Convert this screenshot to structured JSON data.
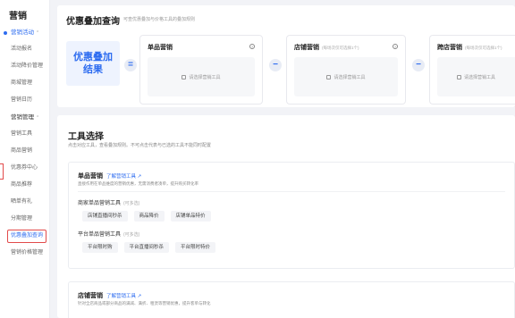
{
  "sidebar": {
    "title": "营销",
    "groups": [
      {
        "label": "营销活动",
        "items": [
          "活动报名",
          "活动降价管理",
          "商城管理",
          "营销日历"
        ]
      },
      {
        "label": "营销管理",
        "items": [
          "营销工具",
          "商品营销",
          "优惠券中心",
          "商品推荐",
          "晒单有礼",
          "分期管理",
          "优惠叠加查询",
          "营销价格管理"
        ]
      }
    ],
    "chevron": "⌃"
  },
  "card1": {
    "title": "优惠叠加查询",
    "desc": "可查优惠叠加与价格工具的叠加规则",
    "result": [
      "优惠叠加",
      "结果"
    ],
    "operators": [
      "=",
      "−",
      "−"
    ],
    "slots": [
      {
        "title": "单品营销",
        "sub": "",
        "placeholder": "请选择营销工具"
      },
      {
        "title": "店铺营销",
        "sub": "(每场次仅可选择1个)",
        "placeholder": "请选择营销工具"
      },
      {
        "title": "跨店营销",
        "sub": "(每场次仅可选择1个)",
        "placeholder": "请选择营销工具"
      }
    ]
  },
  "card2": {
    "title": "工具选择",
    "desc": "点击对应工具，查看叠加规则。不可点击代表与已选的工具不能同时配置",
    "tool1": {
      "title": "单品营销",
      "link": "了解营销工具",
      "desc": "直接作用在单品维度的营销优惠，无需消费者凑单，提升购买转化率",
      "sections": [
        {
          "label": "商家单品营销工具",
          "optional": "(可多选)",
          "chips": [
            "店铺直播间秒杀",
            "商品降价",
            "店铺单品特价"
          ]
        },
        {
          "label": "平台单品营销工具",
          "optional": "(可多选)",
          "chips": [
            "平台限时购",
            "平台直播间秒杀",
            "平台限时特价"
          ]
        }
      ]
    },
    "tool2": {
      "title": "店铺营销",
      "link": "了解营销工具",
      "desc": "针对全店商品或部分商品的满减、满折、租赁等营销优惠，提升客单与转化"
    }
  }
}
